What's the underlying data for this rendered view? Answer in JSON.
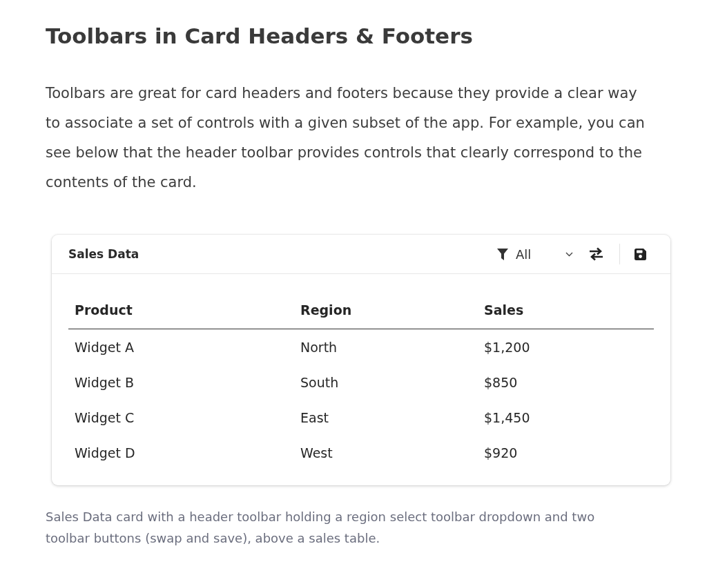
{
  "heading": "Toolbars in Card Headers & Footers",
  "intro": "Toolbars are great for card headers and footers because they provide a clear way to associate a set of controls with a given subset of the app. For example, you can see below that the header toolbar provides controls that clearly correspond to the contents of the card.",
  "card": {
    "title": "Sales Data",
    "toolbar": {
      "select": {
        "value": "All"
      },
      "buttons": [
        {
          "kind": "swap"
        },
        {
          "kind": "save"
        }
      ]
    },
    "table": {
      "columns": [
        "Product",
        "Region",
        "Sales"
      ],
      "rows": [
        [
          "Widget A",
          "North",
          "$1,200"
        ],
        [
          "Widget B",
          "South",
          "$850"
        ],
        [
          "Widget C",
          "East",
          "$1,450"
        ],
        [
          "Widget D",
          "West",
          "$920"
        ]
      ]
    }
  },
  "caption": "Sales Data card with a header toolbar holding a region select toolbar dropdown and two toolbar buttons (swap and save), above a sales table."
}
